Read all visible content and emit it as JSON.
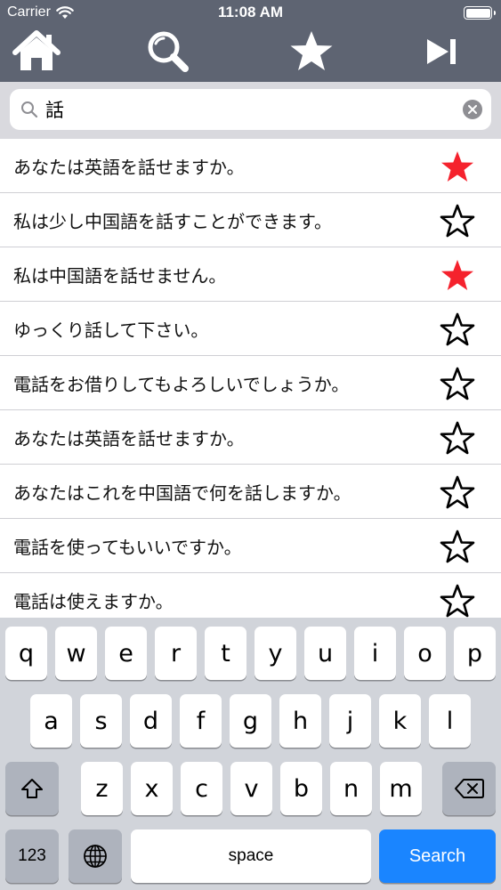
{
  "status_bar": {
    "carrier": "Carrier",
    "time": "11:08 AM",
    "icons": [
      "wifi-icon",
      "battery-icon"
    ]
  },
  "toolbar": {
    "background": "#5e6472",
    "buttons": [
      {
        "icon": "home-icon"
      },
      {
        "icon": "search-icon"
      },
      {
        "icon": "star-icon"
      },
      {
        "icon": "skip-forward-icon"
      }
    ]
  },
  "search": {
    "value": "話",
    "placeholder": "",
    "icon": "magnifier-icon",
    "clear_icon": "clear-icon"
  },
  "results": [
    {
      "text": "あなたは英語を話せますか。",
      "favorite": true
    },
    {
      "text": "私は少し中国語を話すことができます。",
      "favorite": false
    },
    {
      "text": "私は中国語を話せません。",
      "favorite": true
    },
    {
      "text": "ゆっくり話して下さい。",
      "favorite": false
    },
    {
      "text": "電話をお借りしてもよろしいでしょうか。",
      "favorite": false
    },
    {
      "text": "あなたは英語を話せますか。",
      "favorite": false
    },
    {
      "text": "あなたはこれを中国語で何を話しますか。",
      "favorite": false
    },
    {
      "text": "電話を使ってもいいですか。",
      "favorite": false
    },
    {
      "text": "電話は使えますか。",
      "favorite": false
    }
  ],
  "colors": {
    "favorite_star": "#f5222d",
    "empty_star_outline": "#000000",
    "search_key": "#1a85ff"
  },
  "keyboard": {
    "row1": [
      "q",
      "w",
      "e",
      "r",
      "t",
      "y",
      "u",
      "i",
      "o",
      "p"
    ],
    "row2": [
      "a",
      "s",
      "d",
      "f",
      "g",
      "h",
      "j",
      "k",
      "l"
    ],
    "row3": [
      "z",
      "x",
      "c",
      "v",
      "b",
      "n",
      "m"
    ],
    "shift_icon": "shift-icon",
    "backspace_icon": "backspace-icon",
    "numbers_label": "123",
    "globe_icon": "globe-icon",
    "space_label": "space",
    "search_label": "Search"
  }
}
